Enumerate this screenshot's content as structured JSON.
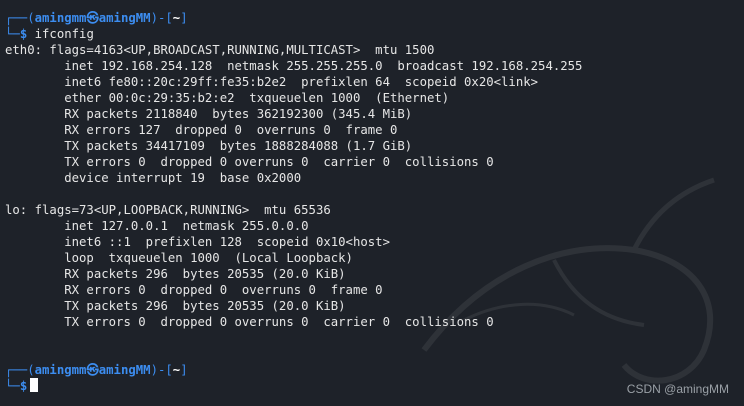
{
  "prompt": {
    "box_top": "┌──(",
    "user_host": "amingmm㉿amingMM",
    "mid": ")-[",
    "cwd": "~",
    "close": "]",
    "box_bottom": "└─",
    "symbol": "$"
  },
  "command": "ifconfig",
  "eth0": {
    "header": "eth0: flags=4163<UP,BROADCAST,RUNNING,MULTICAST>  mtu 1500",
    "lines": [
      "        inet 192.168.254.128  netmask 255.255.255.0  broadcast 192.168.254.255",
      "        inet6 fe80::20c:29ff:fe35:b2e2  prefixlen 64  scopeid 0x20<link>",
      "        ether 00:0c:29:35:b2:e2  txqueuelen 1000  (Ethernet)",
      "        RX packets 2118840  bytes 362192300 (345.4 MiB)",
      "        RX errors 127  dropped 0  overruns 0  frame 0",
      "        TX packets 34417109  bytes 1888284088 (1.7 GiB)",
      "        TX errors 0  dropped 0 overruns 0  carrier 0  collisions 0",
      "        device interrupt 19  base 0x2000"
    ]
  },
  "lo": {
    "header": "lo: flags=73<UP,LOOPBACK,RUNNING>  mtu 65536",
    "lines": [
      "        inet 127.0.0.1  netmask 255.0.0.0",
      "        inet6 ::1  prefixlen 128  scopeid 0x10<host>",
      "        loop  txqueuelen 1000  (Local Loopback)",
      "        RX packets 296  bytes 20535 (20.0 KiB)",
      "        RX errors 0  dropped 0  overruns 0  frame 0",
      "        TX packets 296  bytes 20535 (20.0 KiB)",
      "        TX errors 0  dropped 0 overruns 0  carrier 0  collisions 0"
    ]
  },
  "watermark": "CSDN @amingMM",
  "colors": {
    "background": "#1e2229",
    "prompt_blue": "#3c8df0",
    "text": "#e6e6e6"
  }
}
